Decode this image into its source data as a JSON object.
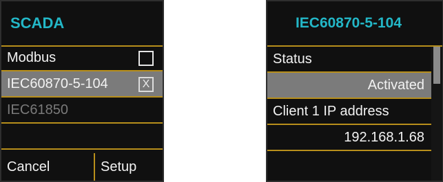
{
  "left_panel": {
    "title": "SCADA",
    "items": [
      {
        "label": "Modbus",
        "check": ""
      },
      {
        "label": "IEC60870-5-104",
        "check": "X"
      },
      {
        "label": "IEC61850"
      }
    ],
    "buttons": {
      "cancel": "Cancel",
      "setup": "Setup"
    }
  },
  "right_panel": {
    "title": "IEC60870-5-104",
    "rows": [
      {
        "label": "Status"
      },
      {
        "value": "Activated"
      },
      {
        "label": "Client 1 IP address"
      },
      {
        "value": "192.168.1.68"
      }
    ]
  },
  "colors": {
    "accent_title": "#23b7c7",
    "divider": "#b88f1b",
    "selected_row": "#7b7b7b",
    "panel_bg": "#101010"
  }
}
